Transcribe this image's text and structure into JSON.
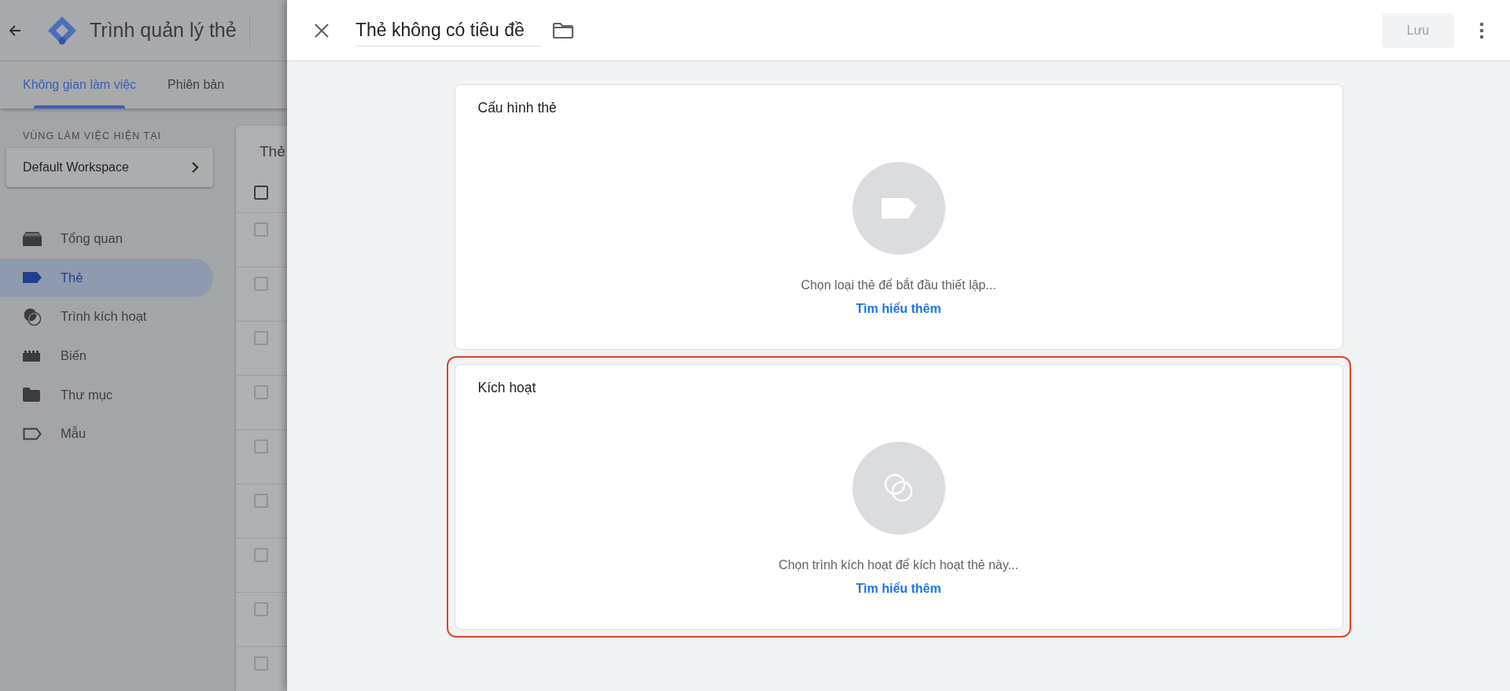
{
  "app": {
    "title": "Trình quản lý thẻ"
  },
  "tabs": [
    {
      "label": "Không gian làm việc",
      "selected": true
    },
    {
      "label": "Phiên bản",
      "selected": false
    }
  ],
  "workspace": {
    "label": "VÙNG LÀM VIỆC HIỆN TẠI",
    "name": "Default Workspace"
  },
  "nav": [
    {
      "label": "Tổng quan",
      "kind": "overview",
      "selected": false
    },
    {
      "label": "Thẻ",
      "kind": "tag",
      "selected": true
    },
    {
      "label": "Trình kích hoạt",
      "kind": "trigger",
      "selected": false
    },
    {
      "label": "Biến",
      "kind": "variable",
      "selected": false
    },
    {
      "label": "Thư mục",
      "kind": "folder",
      "selected": false
    },
    {
      "label": "Mẫu",
      "kind": "template",
      "selected": false
    }
  ],
  "list": {
    "title": "Thẻ",
    "header_checked": false,
    "rows": [
      {
        "checked": false
      },
      {
        "checked": false
      },
      {
        "checked": false
      },
      {
        "checked": false
      },
      {
        "checked": false
      },
      {
        "checked": false
      },
      {
        "checked": false
      },
      {
        "checked": false
      },
      {
        "checked": false
      }
    ]
  },
  "editor": {
    "title": "Thẻ không có tiêu đề",
    "save": {
      "label": "Lưu",
      "disabled": true
    },
    "sections": [
      {
        "title": "Cấu hình thẻ",
        "kind": "tag",
        "hint": "Chọn loại thẻ để bắt đầu thiết lập...",
        "link": "Tìm hiểu thêm",
        "highlighted": false
      },
      {
        "title": "Kích hoạt",
        "kind": "trigger",
        "hint": "Chọn trình kích hoạt để kích hoạt thẻ này...",
        "link": "Tìm hiểu thêm",
        "highlighted": true
      }
    ]
  }
}
